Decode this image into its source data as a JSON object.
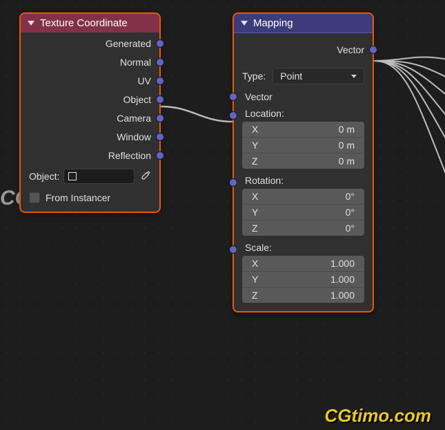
{
  "texcoord": {
    "title": "Texture Coordinate",
    "outputs": [
      "Generated",
      "Normal",
      "UV",
      "Object",
      "Camera",
      "Window",
      "Reflection"
    ],
    "object_label": "Object:",
    "from_instancer": "From Instancer"
  },
  "mapping": {
    "title": "Mapping",
    "output": "Vector",
    "type_label": "Type:",
    "type_value": "Point",
    "input_vector": "Vector",
    "location": {
      "label": "Location:",
      "x_label": "X",
      "x_value": "0 m",
      "y_label": "Y",
      "y_value": "0 m",
      "z_label": "Z",
      "z_value": "0 m"
    },
    "rotation": {
      "label": "Rotation:",
      "x_label": "X",
      "x_value": "0°",
      "y_label": "Y",
      "y_value": "0°",
      "z_label": "Z",
      "z_value": "0°"
    },
    "scale": {
      "label": "Scale:",
      "x_label": "X",
      "x_value": "1.000",
      "y_label": "Y",
      "y_value": "1.000",
      "z_label": "Z",
      "z_value": "1.000"
    }
  },
  "watermark1": "CGtimo",
  "watermark2": "CGtimo.com"
}
